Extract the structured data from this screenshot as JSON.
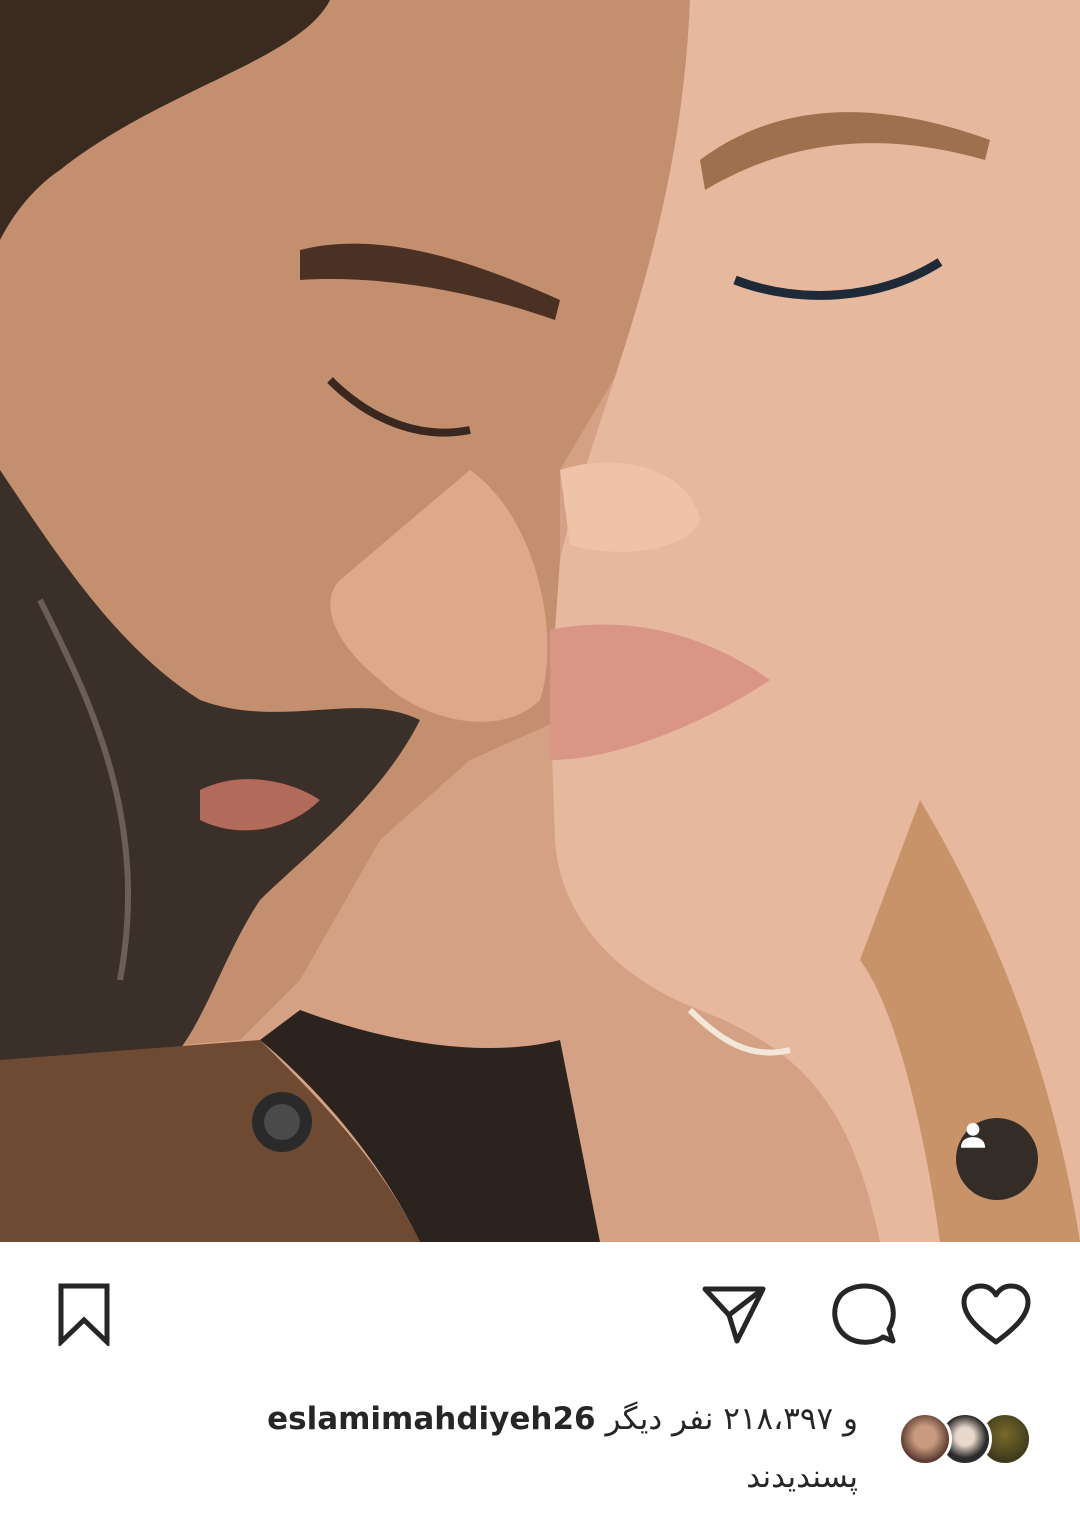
{
  "post": {
    "image_alt": "photo-post",
    "tag_icon": "person-icon"
  },
  "actions": {
    "like_icon": "heart-icon",
    "comment_icon": "comment-icon",
    "share_icon": "send-icon",
    "save_icon": "bookmark-icon"
  },
  "likes": {
    "prefix": "و ۲۱۸،۳۹۷ نفر دیگر",
    "username": "eslamimahdiyeh26",
    "suffix": "پسندیدند"
  },
  "colors": {
    "text": "#262626",
    "background": "#ffffff",
    "tag_button": "#1e1e1e"
  }
}
